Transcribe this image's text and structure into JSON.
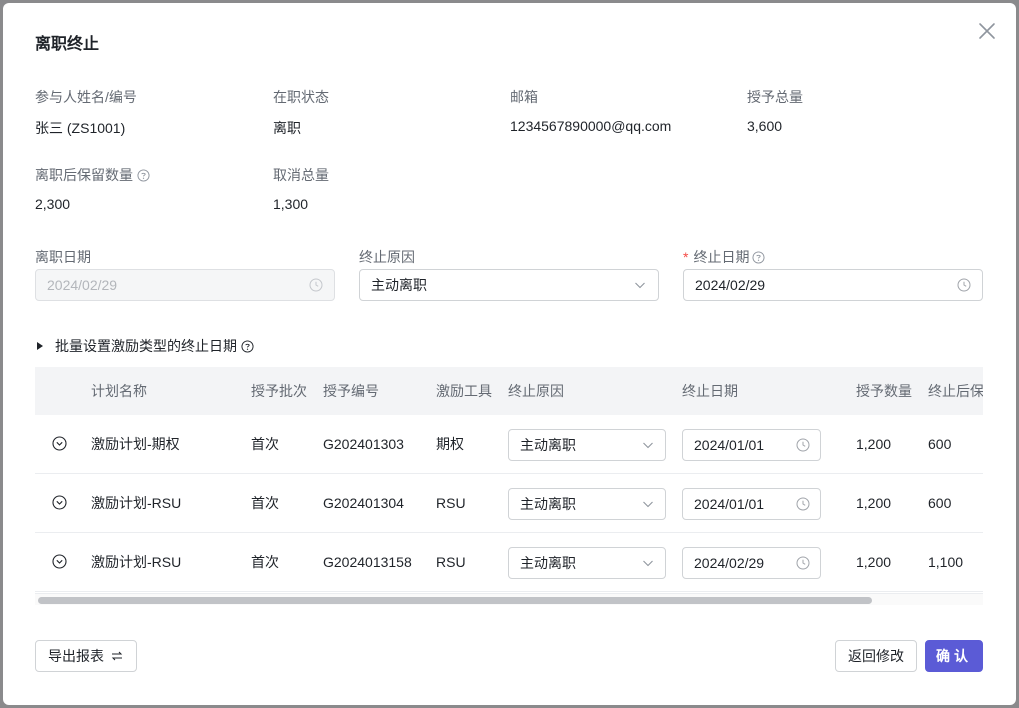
{
  "modal": {
    "title": "离职终止",
    "info": {
      "participant_label": "参与人姓名/编号",
      "participant_value": "张三 (ZS1001)",
      "status_label": "在职状态",
      "status_value": "离职",
      "email_label": "邮箱",
      "email_value": "1234567890000@qq.com",
      "grant_total_label": "授予总量",
      "grant_total_value": "3,600",
      "retained_label": "离职后保留数量",
      "retained_value": "2,300",
      "cancel_total_label": "取消总量",
      "cancel_total_value": "1,300"
    },
    "form": {
      "leave_date_label": "离职日期",
      "leave_date_value": "2024/02/29",
      "reason_label": "终止原因",
      "reason_value": "主动离职",
      "end_date_label": "终止日期",
      "end_date_required": "*",
      "end_date_value": "2024/02/29"
    },
    "batch_label": "批量设置激励类型的终止日期",
    "table": {
      "headers": [
        "计划名称",
        "授予批次",
        "授予编号",
        "激励工具",
        "终止原因",
        "终止日期",
        "授予数量",
        "终止后保留"
      ],
      "rows": [
        {
          "plan": "激励计划-期权",
          "batch": "首次",
          "grant_no": "G202401303",
          "tool": "期权",
          "reason": "主动离职",
          "date": "2024/01/01",
          "qty": "1,200",
          "retained": "600"
        },
        {
          "plan": "激励计划-RSU",
          "batch": "首次",
          "grant_no": "G202401304",
          "tool": "RSU",
          "reason": "主动离职",
          "date": "2024/01/01",
          "qty": "1,200",
          "retained": "600"
        },
        {
          "plan": "激励计划-RSU",
          "batch": "首次",
          "grant_no": "G2024013158",
          "tool": "RSU",
          "reason": "主动离职",
          "date": "2024/02/29",
          "qty": "1,200",
          "retained": "1,100"
        }
      ]
    },
    "footer": {
      "export_label": "导出报表",
      "back_label": "返回修改",
      "confirm_label": "确认"
    },
    "colors": {
      "primary": "#5b5bd6",
      "required": "#f54a45",
      "header_bg": "#f3f4f6"
    },
    "icons": [
      "close-icon",
      "help-icon",
      "clock-icon",
      "chevron-down-icon",
      "caret-right-icon",
      "expand-circle-icon",
      "swap-icon"
    ]
  }
}
